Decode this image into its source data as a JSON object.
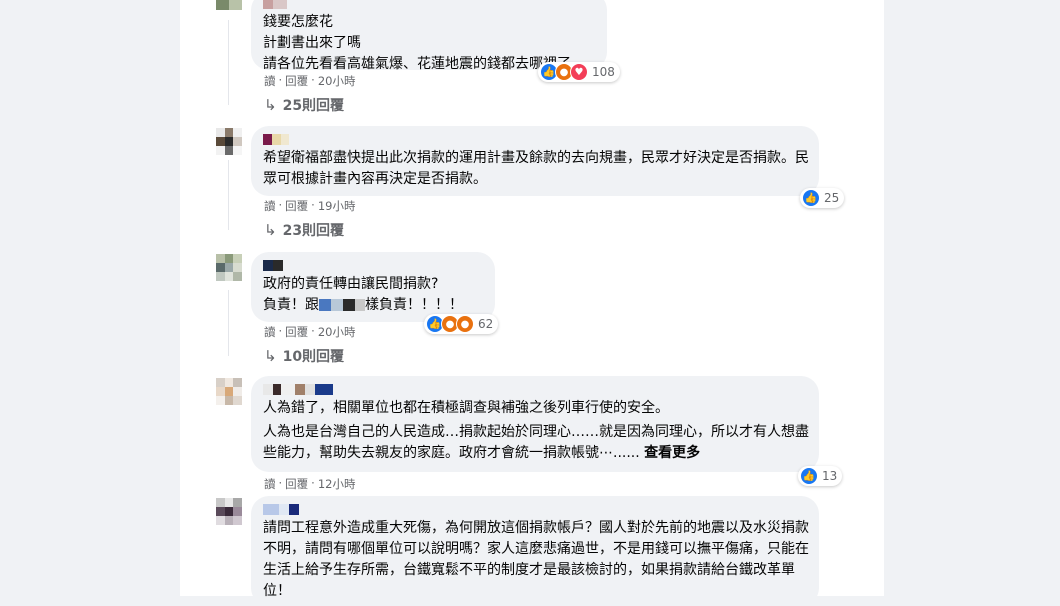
{
  "comments": [
    {
      "text": "錢要怎麼花\n計劃書出來了嗎\n請各位先看看高雄氣爆、花蓮地震的錢都去哪裡了",
      "reaction_count": "108",
      "reaction_icons": [
        "like-icon",
        "angry-icon",
        "love-icon"
      ],
      "action_read": "讀",
      "action_reply": "回覆",
      "time": "20小時",
      "replies_label": "25則回覆"
    },
    {
      "text": "希望衛福部盡快提出此次捐款的運用計畫及餘款的去向規畫，民眾才好決定是否捐款。民眾可根據計畫內容再決定是否捐款。",
      "reaction_count": "25",
      "reaction_icons": [
        "like-icon"
      ],
      "action_read": "讀",
      "action_reply": "回覆",
      "time": "19小時",
      "replies_label": "23則回覆"
    },
    {
      "text_line1": "政府的責任轉由讓民間捐款?",
      "text_line2_before": "負責！跟",
      "text_line2_after": "樣負責！！！！",
      "reaction_count": "62",
      "reaction_icons": [
        "like-icon",
        "angry-icon",
        "angry-icon"
      ],
      "action_read": "讀",
      "action_reply": "回覆",
      "time": "20小時",
      "replies_label": "10則回覆"
    },
    {
      "text_p1": "人為錯了，相關單位也都在積極調查與補強之後列車行使的安全。",
      "text_p2": "人為也是台灣自己的人民造成…捐款起始於同理心……就是因為同理心，所以才有人想盡些能力，幫助失去親友的家庭。政府才會統一捐款帳號⋯......",
      "see_more": "查看更多",
      "reaction_count": "13",
      "reaction_icons": [
        "like-icon"
      ],
      "action_read": "讀",
      "action_reply": "回覆",
      "time": "12小時"
    },
    {
      "text": "請問工程意外造成重大死傷，為何開放這個捐款帳戶？國人對於先前的地震以及水災捐款不明，請問有哪個單位可以說明嗎？家人這麼悲痛過世，不是用錢可以撫平傷痛，只能在生活上給予生存所需，台鐵寬鬆不平的制度才是最該檢討的，如果捐款請給台鐵改革單位！"
    }
  ],
  "colors": {
    "page_bg": "#f0f2f5",
    "bubble_bg": "#f0f2f5",
    "like": "#1877f2",
    "angry": "#e9710f",
    "love": "#f33e58",
    "meta_text": "#65676b"
  }
}
